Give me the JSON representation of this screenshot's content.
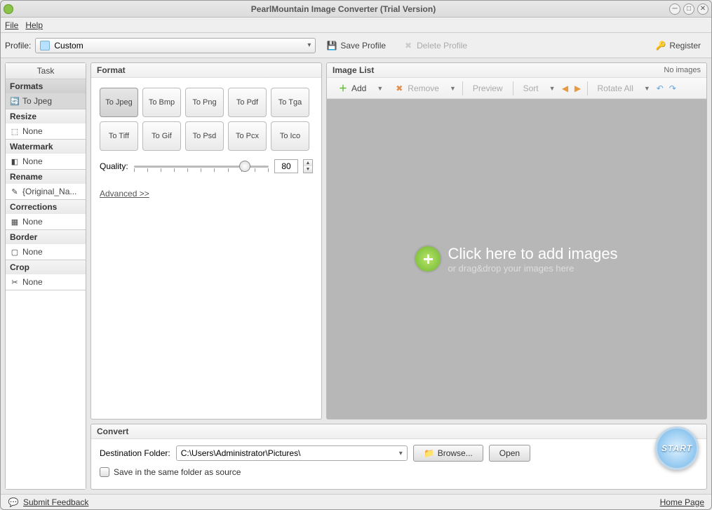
{
  "window": {
    "title": "PearlMountain Image Converter (Trial Version)"
  },
  "menu": {
    "file": "File",
    "help": "Help"
  },
  "toolbar": {
    "profile_label": "Profile:",
    "profile_value": "Custom",
    "save_profile": "Save Profile",
    "delete_profile": "Delete Profile",
    "register": "Register"
  },
  "task": {
    "title": "Task",
    "groups": [
      {
        "name": "Formats",
        "value": "To Jpeg",
        "icon": "refresh-icon",
        "selected": true
      },
      {
        "name": "Resize",
        "value": "None",
        "icon": "resize-icon",
        "selected": false
      },
      {
        "name": "Watermark",
        "value": "None",
        "icon": "watermark-icon",
        "selected": false
      },
      {
        "name": "Rename",
        "value": "{Original_Na...",
        "icon": "pencil-icon",
        "selected": false
      },
      {
        "name": "Corrections",
        "value": "None",
        "icon": "corrections-icon",
        "selected": false
      },
      {
        "name": "Border",
        "value": "None",
        "icon": "border-icon",
        "selected": false
      },
      {
        "name": "Crop",
        "value": "None",
        "icon": "crop-icon",
        "selected": false
      }
    ]
  },
  "format": {
    "title": "Format",
    "buttons": [
      "To Jpeg",
      "To Bmp",
      "To Png",
      "To Pdf",
      "To Tga",
      "To Tiff",
      "To Gif",
      "To Psd",
      "To Pcx",
      "To Ico"
    ],
    "selected": 0,
    "quality_label": "Quality:",
    "quality_value": "80",
    "advanced": "Advanced >>"
  },
  "imagelist": {
    "title": "Image List",
    "status": "No images",
    "add": "Add",
    "remove": "Remove",
    "preview": "Preview",
    "sort": "Sort",
    "rotate_all": "Rotate All",
    "empty_big": "Click here to add images",
    "empty_small": "or drag&drop your images here"
  },
  "convert": {
    "title": "Convert",
    "dest_label": "Destination Folder:",
    "dest_value": "C:\\Users\\Administrator\\Pictures\\",
    "browse": "Browse...",
    "open": "Open",
    "same_folder": "Save in the same folder as source",
    "start": "START"
  },
  "status": {
    "feedback": "Submit Feedback",
    "homepage": "Home Page"
  }
}
